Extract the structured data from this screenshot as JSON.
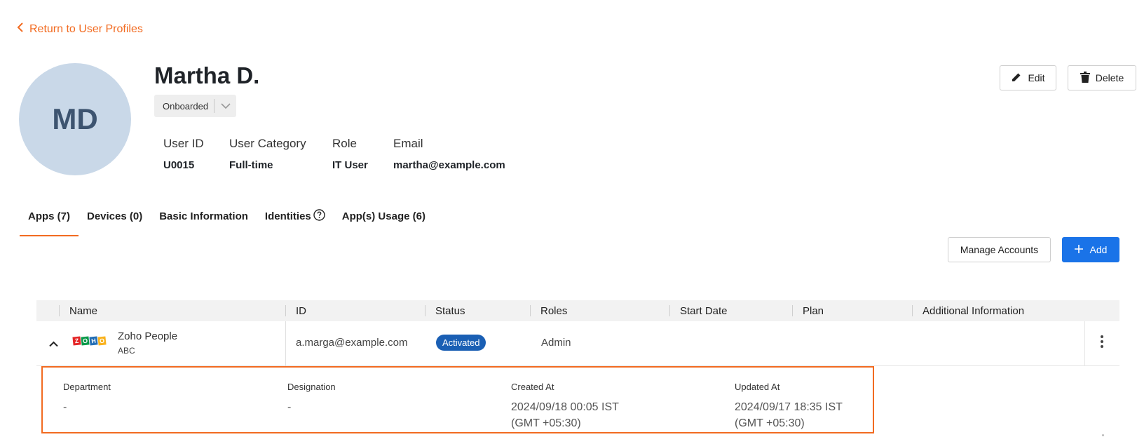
{
  "nav": {
    "back_label": "Return to User Profiles"
  },
  "profile": {
    "initials": "MD",
    "name": "Martha D.",
    "status": "Onboarded",
    "fields": [
      {
        "key": "User ID",
        "value": "U0015"
      },
      {
        "key": "User Category",
        "value": "Full-time"
      },
      {
        "key": "Role",
        "value": "IT User"
      },
      {
        "key": "Email",
        "value": "martha@example.com"
      }
    ]
  },
  "actions": {
    "edit_label": "Edit",
    "delete_label": "Delete"
  },
  "tabs": [
    {
      "label": "Apps (7)",
      "active": true
    },
    {
      "label": "Devices (0)"
    },
    {
      "label": "Basic Information"
    },
    {
      "label": "Identities"
    },
    {
      "label": "App(s) Usage (6)"
    }
  ],
  "toolbar": {
    "manage_label": "Manage Accounts",
    "add_label": "Add"
  },
  "table": {
    "columns": [
      "Name",
      "ID",
      "Status",
      "Roles",
      "Start Date",
      "Plan",
      "Additional Information"
    ],
    "rows": [
      {
        "app_name": "Zoho People",
        "org": "ABC",
        "id": "a.marga@example.com",
        "status": "Activated",
        "role": "Admin",
        "logo_letters": [
          "Z",
          "O",
          "H",
          "O"
        ]
      }
    ]
  },
  "details": [
    {
      "key": "Department",
      "value": "-"
    },
    {
      "key": "Designation",
      "value": "-"
    },
    {
      "key": "Created At",
      "value": "2024/09/18 00:05 IST",
      "value2": "(GMT +05:30)"
    },
    {
      "key": "Updated At",
      "value": "2024/09/17 18:35 IST",
      "value2": "(GMT +05:30)"
    }
  ],
  "colors": {
    "accent": "#f26b21",
    "primary": "#1a73e8",
    "badge": "#1a5fb4",
    "avatar_bg": "#c9d8e8",
    "avatar_text": "#3d5470"
  },
  "icons": [
    "chevron-left-icon",
    "chevron-down-icon",
    "pencil-icon",
    "trash-icon",
    "help-circle-icon",
    "plus-icon",
    "chevron-up-icon",
    "more-vertical-icon"
  ]
}
